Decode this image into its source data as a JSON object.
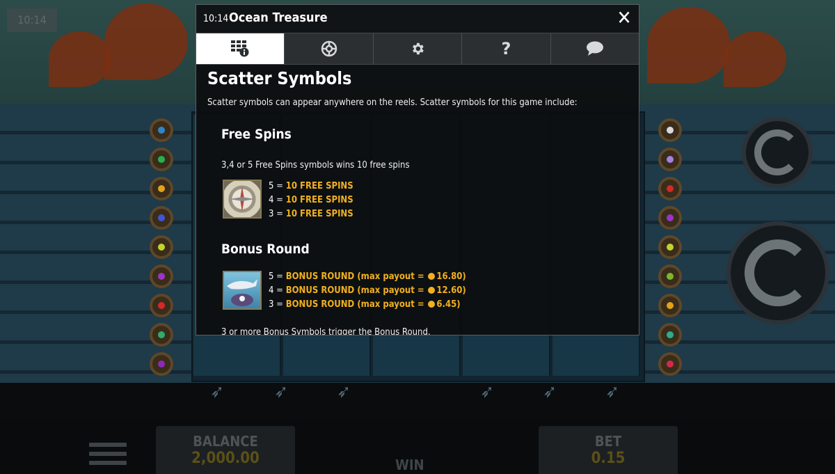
{
  "window": {
    "clock": "10:14",
    "title": "Ocean Treasure"
  },
  "tabs": [
    {
      "icon": "paytable-info-icon",
      "active": true
    },
    {
      "icon": "paylines-icon",
      "active": false
    },
    {
      "icon": "gear-icon",
      "active": false
    },
    {
      "icon": "help-icon",
      "active": false
    },
    {
      "icon": "chat-icon",
      "active": false
    }
  ],
  "section": {
    "title": "Scatter Symbols",
    "intro": "Scatter symbols can appear anywhere on the reels. Scatter symbols for this game include:"
  },
  "free_spins": {
    "title": "Free Spins",
    "description": "3,4 or 5 Free Spins symbols wins 10 free spins",
    "payouts": [
      {
        "count": "5",
        "reward": "10 FREE SPINS"
      },
      {
        "count": "4",
        "reward": "10 FREE SPINS"
      },
      {
        "count": "3",
        "reward": "10 FREE SPINS"
      }
    ]
  },
  "bonus_round": {
    "title": "Bonus Round",
    "payouts": [
      {
        "count": "5",
        "reward": "BONUS ROUND (max payout =",
        "amount": "16.80)"
      },
      {
        "count": "4",
        "reward": "BONUS ROUND (max payout =",
        "amount": "12.60)"
      },
      {
        "count": "3",
        "reward": "BONUS ROUND (max payout =",
        "amount": "6.45)"
      }
    ],
    "trigger_text": "3 or more Bonus Symbols trigger the Bonus Round."
  },
  "game_bar": {
    "balance_label": "BALANCE",
    "balance_value": "2,000.00",
    "win_label": "WIN",
    "bet_label": "BET",
    "bet_value": "0.15",
    "time_chip": "10:14"
  },
  "colors": {
    "accent_gold": "#f2b01e",
    "tab_active_bg": "#ffffff",
    "tab_bg": "#2b2f32"
  }
}
